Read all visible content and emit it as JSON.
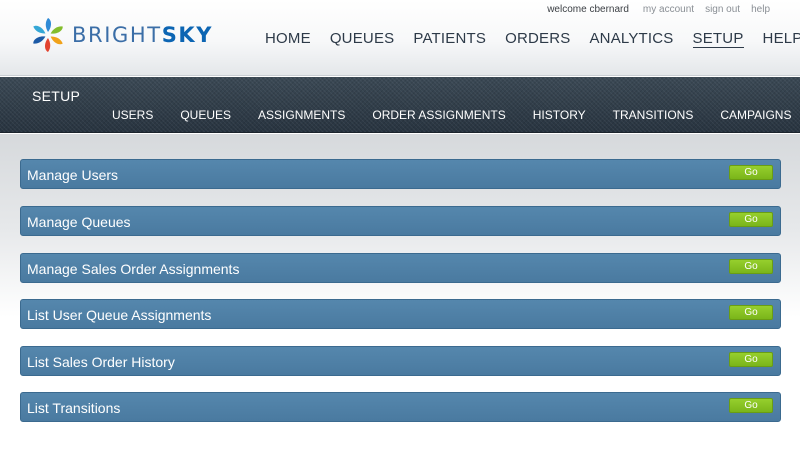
{
  "header": {
    "logo": {
      "bright": "BRIGHT",
      "sky": "SKY"
    },
    "user_links": {
      "welcome": "welcome cbernard",
      "my_account": "my account",
      "sign_out": "sign out",
      "help": "help"
    },
    "main_nav": [
      {
        "label": "HOME"
      },
      {
        "label": "QUEUES"
      },
      {
        "label": "PATIENTS"
      },
      {
        "label": "ORDERS"
      },
      {
        "label": "ANALYTICS"
      },
      {
        "label": "SETUP",
        "active": true
      },
      {
        "label": "HELP"
      }
    ]
  },
  "subheader": {
    "section_title": "SETUP",
    "tabs": [
      {
        "label": "USERS"
      },
      {
        "label": "QUEUES"
      },
      {
        "label": "ASSIGNMENTS"
      },
      {
        "label": "ORDER ASSIGNMENTS"
      },
      {
        "label": "HISTORY"
      },
      {
        "label": "TRANSITIONS"
      },
      {
        "label": "CAMPAIGNS"
      }
    ]
  },
  "panels": [
    {
      "label": "Manage Users",
      "button": "Go"
    },
    {
      "label": "Manage Queues",
      "button": "Go"
    },
    {
      "label": "Manage Sales Order Assignments",
      "button": "Go"
    },
    {
      "label": "List User Queue Assignments",
      "button": "Go"
    },
    {
      "label": "List Sales Order History",
      "button": "Go"
    },
    {
      "label": "List Transitions",
      "button": "Go"
    }
  ],
  "colors": {
    "brand_blue": "#0c65b3",
    "panel_blue": "#4e7fa6",
    "go_green": "#86c220",
    "nav_dark": "#2e3b46"
  }
}
